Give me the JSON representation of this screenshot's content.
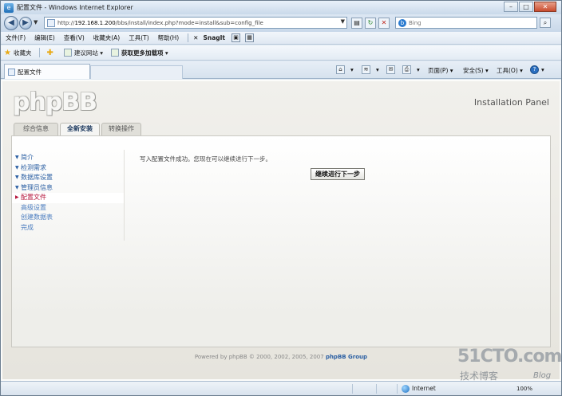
{
  "window": {
    "title": "配置文件 - Windows Internet Explorer",
    "controls": {
      "minimize": "–",
      "maximize": "□",
      "close": "✕"
    }
  },
  "addressbar": {
    "host": "192.168.1.200",
    "url_rest": "/bbs/install/index.php?mode=install&sub=config_file",
    "url_prefix": "http://",
    "search_placeholder": "Bing"
  },
  "menu": {
    "items": [
      "文件(F)",
      "编辑(E)",
      "查看(V)",
      "收藏夹(A)",
      "工具(T)",
      "帮助(H)"
    ],
    "snagit": "SnagIt"
  },
  "favorites": {
    "label": "收藏夹",
    "suggested_sites": "建议网站",
    "more_addons": "获取更多加载项"
  },
  "tab": {
    "title": "配置文件"
  },
  "commandbar": {
    "page": "页面(P)",
    "safety": "安全(S)",
    "tools": "工具(O)",
    "help_icon": "?"
  },
  "page": {
    "logo": "phpBB",
    "panel_title": "Installation Panel",
    "tabs": [
      {
        "label": "综合信息",
        "active": false
      },
      {
        "label": "全新安装",
        "active": true
      },
      {
        "label": "转换操作",
        "active": false
      }
    ],
    "nav": [
      {
        "label": "简介",
        "state": "done"
      },
      {
        "label": "检测需求",
        "state": "done"
      },
      {
        "label": "数据库设置",
        "state": "done"
      },
      {
        "label": "管理员信息",
        "state": "done"
      },
      {
        "label": "配置文件",
        "state": "active"
      },
      {
        "label": "高级设置",
        "state": "pending"
      },
      {
        "label": "创建数据表",
        "state": "pending"
      },
      {
        "label": "完成",
        "state": "pending"
      }
    ],
    "message": "写入配置文件成功。您现在可以继续进行下一步。",
    "continue_button": "继续进行下一步",
    "footer_prefix": "Powered by phpBB © 2000, 2002, 2005, 2007 ",
    "footer_group": "phpBB Group"
  },
  "statusbar": {
    "zone": "Internet",
    "zoom": "100%"
  },
  "watermark": {
    "site": "51CTO.com",
    "sub": "技术博客",
    "blog": "Blog"
  },
  "colors": {
    "nav_link": "#2b5fa3",
    "nav_active": "#b5153b",
    "tab_active_text": "#1e3a5f"
  },
  "icons": [
    "ie-page-icon",
    "back-icon",
    "forward-icon",
    "refresh-icon",
    "stop-icon",
    "search-icon",
    "star-icon",
    "globe-icon",
    "home-icon",
    "print-icon",
    "help-icon"
  ]
}
